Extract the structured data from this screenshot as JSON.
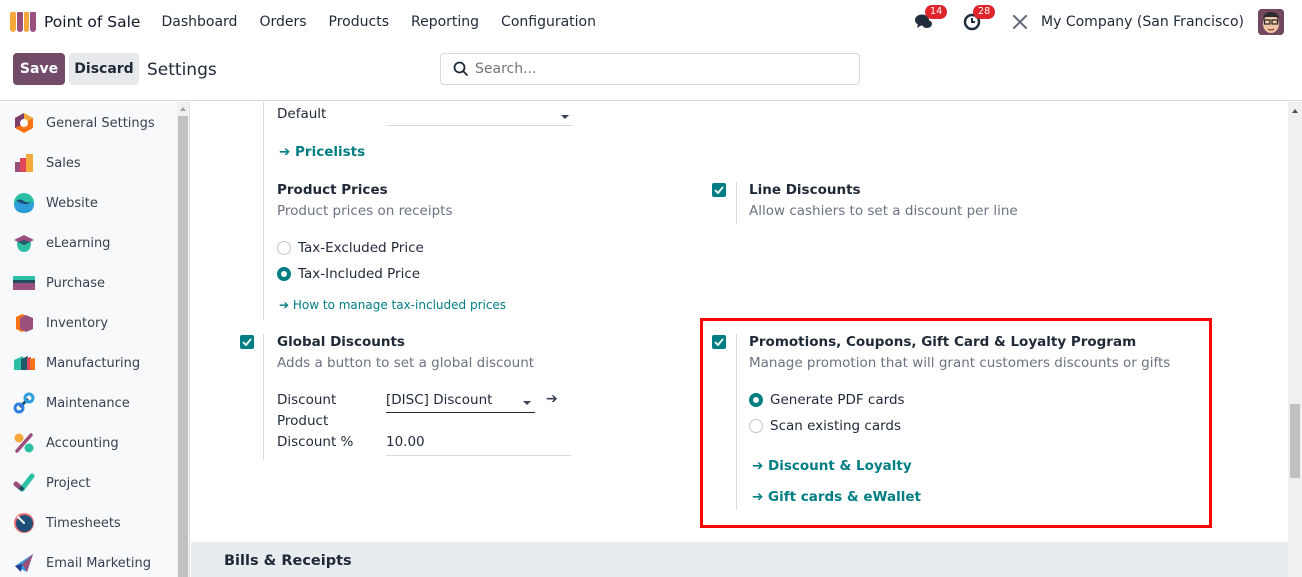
{
  "navbar": {
    "app_title": "Point of Sale",
    "menu": [
      "Dashboard",
      "Orders",
      "Products",
      "Reporting",
      "Configuration"
    ],
    "messages_badge": "14",
    "activities_badge": "28",
    "company": "My Company (San Francisco)",
    "icons": {
      "app": "point-of-sale-icon",
      "messages": "chat-bubbles-icon",
      "activities": "clock-icon",
      "debug": "tools-icon",
      "user": "user-avatar"
    }
  },
  "control_panel": {
    "save_label": "Save",
    "discard_label": "Discard",
    "title": "Settings",
    "search_placeholder": "Search..."
  },
  "sidebar": {
    "items": [
      {
        "label": "General Settings",
        "icon": "general-settings-icon"
      },
      {
        "label": "Sales",
        "icon": "sales-icon"
      },
      {
        "label": "Website",
        "icon": "website-icon"
      },
      {
        "label": "eLearning",
        "icon": "elearning-icon"
      },
      {
        "label": "Purchase",
        "icon": "purchase-icon"
      },
      {
        "label": "Inventory",
        "icon": "inventory-icon"
      },
      {
        "label": "Manufacturing",
        "icon": "manufacturing-icon"
      },
      {
        "label": "Maintenance",
        "icon": "maintenance-icon"
      },
      {
        "label": "Accounting",
        "icon": "accounting-icon"
      },
      {
        "label": "Project",
        "icon": "project-icon"
      },
      {
        "label": "Timesheets",
        "icon": "timesheets-icon"
      },
      {
        "label": "Email Marketing",
        "icon": "email-marketing-icon"
      }
    ]
  },
  "settings": {
    "pricelist": {
      "value": "Default",
      "link": "Pricelists"
    },
    "product_prices": {
      "title": "Product Prices",
      "description": "Product prices on receipts",
      "options": [
        {
          "label": "Tax-Excluded Price",
          "selected": false
        },
        {
          "label": "Tax-Included Price",
          "selected": true
        }
      ],
      "help_link": "How to manage tax-included prices"
    },
    "line_discounts": {
      "title": "Line Discounts",
      "description": "Allow cashiers to set a discount per line",
      "checked": true
    },
    "global_discounts": {
      "title": "Global Discounts",
      "description": "Adds a button to set a global discount",
      "checked": true,
      "discount_product_label_1": "Discount",
      "discount_product_label_2": "Product",
      "discount_product_value": "[DISC] Discount",
      "discount_percent_label": "Discount %",
      "discount_percent_value": "10.00"
    },
    "promotions": {
      "title": "Promotions, Coupons, Gift Card & Loyalty Program",
      "description": "Manage promotion that will grant customers discounts or gifts",
      "checked": true,
      "options": [
        {
          "label": "Generate PDF cards",
          "selected": true
        },
        {
          "label": "Scan existing cards",
          "selected": false
        }
      ],
      "links": [
        "Discount & Loyalty",
        "Gift cards & eWallet"
      ]
    }
  },
  "section": {
    "title": "Bills & Receipts"
  },
  "colors": {
    "brand": "#714b67",
    "accent": "#017e84",
    "highlight": "#ff0000",
    "badge": "#e0242c"
  }
}
